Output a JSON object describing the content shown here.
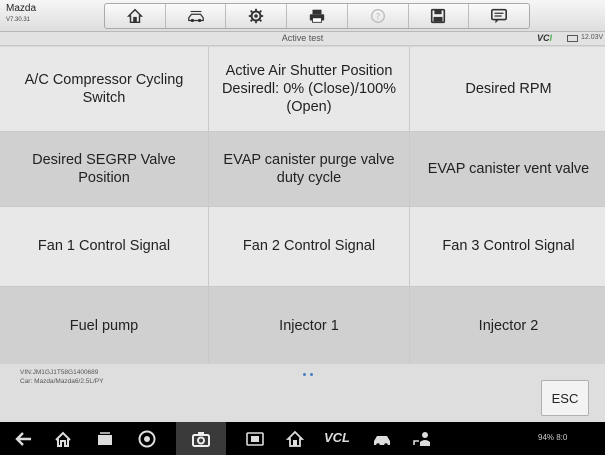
{
  "app": {
    "title": "Mazda",
    "version": "V7.30.31"
  },
  "toolbar": {
    "buttons": [
      {
        "icon": "home-icon"
      },
      {
        "icon": "vehicle-swap-icon"
      },
      {
        "icon": "settings-icon"
      },
      {
        "icon": "print-icon"
      },
      {
        "icon": "help-icon"
      },
      {
        "icon": "save-icon"
      },
      {
        "icon": "message-icon"
      }
    ]
  },
  "status": {
    "mode_title": "Active test",
    "vci_logo_main": "VC",
    "vci_logo_accent": "I",
    "voltage": "12.03V"
  },
  "tests": [
    "A/C Compressor Cycling Switch",
    "Active Air Shutter Position Desiredl: 0% (Close)/100% (Open)",
    "Desired RPM",
    "Desired SEGRP Valve Position",
    "EVAP canister purge valve duty cycle",
    "EVAP canister vent valve",
    "Fan 1 Control Signal",
    "Fan 2 Control Signal",
    "Fan 3 Control Signal",
    "Fuel pump",
    "Injector 1",
    "Injector 2"
  ],
  "vehicle": {
    "vin": "VIN:JM1GJ1T58G1400689",
    "car": "Car: Mazda/Mazda6/2.5L/PY"
  },
  "esc_label": "ESC",
  "navbar": {
    "vcl_label": "VCL",
    "system_status": "94% 8:0"
  },
  "colors": {
    "accent": "#4caf50",
    "dots": "#4a7ec7"
  }
}
